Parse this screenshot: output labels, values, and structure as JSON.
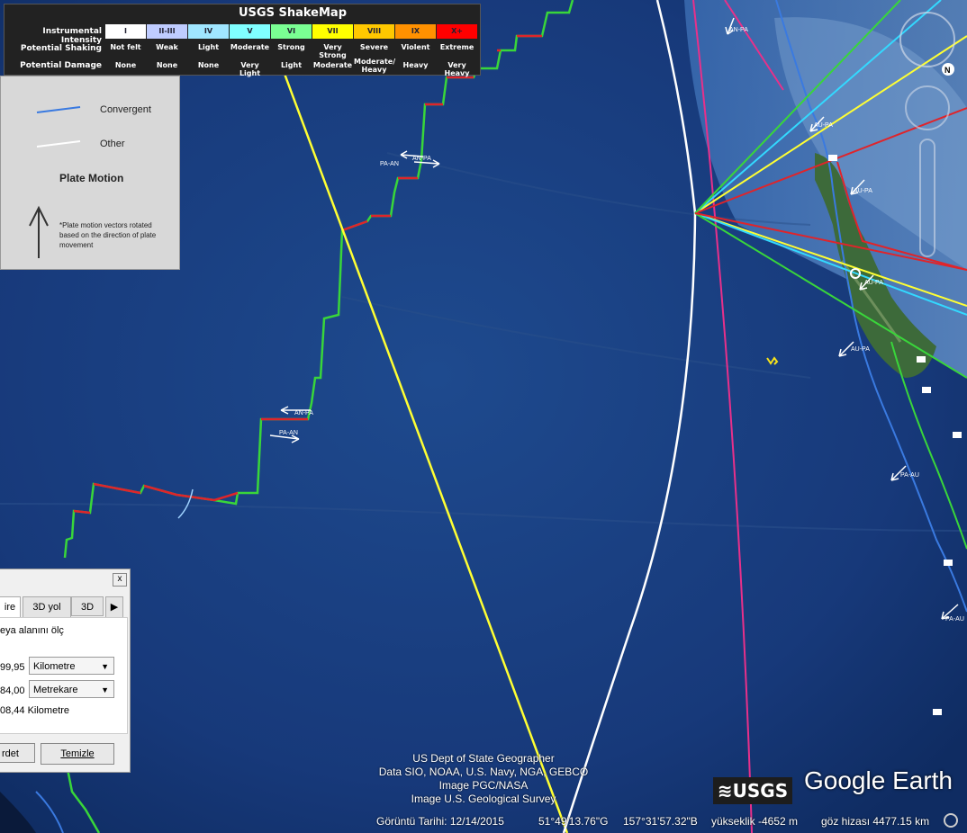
{
  "legend": {
    "title": "USGS ShakeMap",
    "rows": {
      "intensity": "Instrumental Intensity",
      "shaking": "Potential Shaking",
      "damage": "Potential Damage"
    },
    "levels": [
      "I",
      "II-III",
      "IV",
      "V",
      "VI",
      "VII",
      "VIII",
      "IX",
      "X+"
    ],
    "colors": [
      "#ffffff",
      "#bfccff",
      "#a0e6ff",
      "#80ffff",
      "#7aff93",
      "#ffff00",
      "#ffc800",
      "#ff9100",
      "#ff0000"
    ],
    "shaking": [
      "Not felt",
      "Weak",
      "Light",
      "Moderate",
      "Strong",
      "Very Strong",
      "Severe",
      "Violent",
      "Extreme"
    ],
    "damage": [
      "None",
      "None",
      "None",
      "Very Light",
      "Light",
      "Moderate",
      "Moderate/ Heavy",
      "Heavy",
      "Very Heavy"
    ]
  },
  "plate_legend": {
    "convergent": "Convergent",
    "other": "Other",
    "heading": "Plate Motion",
    "note": "*Plate motion vectors rotated based on the direction of plate movement"
  },
  "map_labels": [
    "AN-PA",
    "PA-AN",
    "AN-PA",
    "PA-AN",
    "AU-PA",
    "AU-PA",
    "AU-PA",
    "AU-PA",
    "PA-AU",
    "PA-AU",
    "AN-PA"
  ],
  "ruler": {
    "tab_active": "ire",
    "tab_2": "3D yol",
    "tab_3": "3D",
    "desc": "eya alanını ölç",
    "perimeter_value": "99,95",
    "perimeter_unit": "Kilometre",
    "area_value": "84,00",
    "area_unit": "Metrekare",
    "heading_value": "08,44 Kilometre",
    "save_label": "rdet",
    "clear_label": "Temizle",
    "close": "x"
  },
  "credits": [
    "US Dept of State Geographer",
    "Data SIO, NOAA, U.S. Navy, NGA, GEBCO",
    "Image PGC/NASA",
    "Image U.S. Geological Survey"
  ],
  "brand": {
    "usgs": "≋USGS",
    "google_earth": "Google Earth"
  },
  "status": {
    "date": "Görüntü Tarihi: 12/14/2015",
    "lat": "51°49'13.76\"G",
    "lon": "157°31'57.32\"B",
    "elevation": "yükseklik -4652 m",
    "eye_alt": "göz hizası 4477.15 km"
  }
}
